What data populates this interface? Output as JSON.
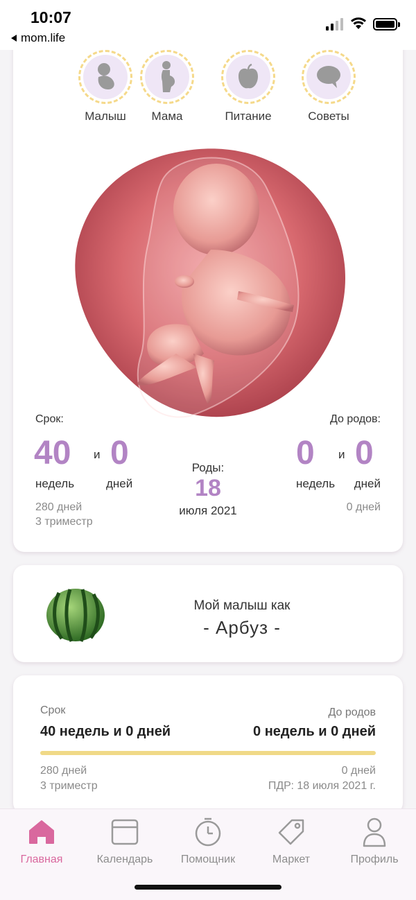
{
  "status": {
    "time": "10:07",
    "back_label": "mom.life"
  },
  "categories": [
    {
      "label": "Малыш",
      "icon": "baby-icon"
    },
    {
      "label": "Мама",
      "icon": "pregnant-mom-icon"
    },
    {
      "label": "Питание",
      "icon": "apple-icon"
    },
    {
      "label": "Советы",
      "icon": "chat-bubble-icon"
    }
  ],
  "pregnancy": {
    "term_label": "Срок:",
    "term_weeks": "40",
    "term_and": "и",
    "term_days": "0",
    "weeks_unit": "недель",
    "days_unit": "дней",
    "total_days": "280 дней",
    "trimester": "3 триместр",
    "birth_label": "Роды:",
    "birth_day": "18",
    "birth_month_year": "июля 2021",
    "remaining_label": "До родов:",
    "remaining_weeks": "0",
    "remaining_and": "и",
    "remaining_days": "0",
    "remaining_total": "0 дней"
  },
  "fruit": {
    "label": "Мой малыш как",
    "name": "- Арбуз -",
    "icon": "watermelon-icon"
  },
  "progress": {
    "term_label": "Срок",
    "term_value": "40 недель и 0 дней",
    "remaining_label": "До родов",
    "remaining_value": "0 недель и 0 дней",
    "progress_fraction": 1.0,
    "total_days": "280 дней",
    "trimester": "3 триместр",
    "remaining_days": "0 дней",
    "due_date": "ПДР: 18 июля 2021 г."
  },
  "tabs": [
    {
      "label": "Главная",
      "icon": "home-icon",
      "active": true
    },
    {
      "label": "Календарь",
      "icon": "calendar-icon",
      "active": false
    },
    {
      "label": "Помощник",
      "icon": "timer-icon",
      "active": false
    },
    {
      "label": "Маркет",
      "icon": "tag-icon",
      "active": false
    },
    {
      "label": "Профиль",
      "icon": "profile-icon",
      "active": false
    }
  ],
  "colors": {
    "accent_purple": "#b284c4",
    "accent_pink": "#d9689e",
    "progress_bar": "#f0d987"
  }
}
